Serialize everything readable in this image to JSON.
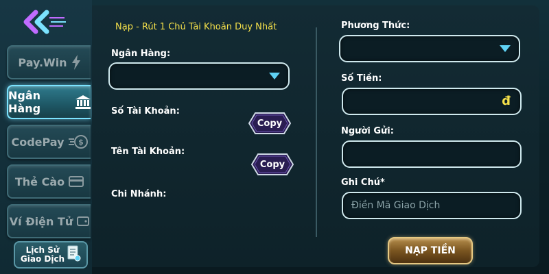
{
  "sidebar": {
    "back_icon": "double-chevron-left-icon",
    "tabs": [
      {
        "label": "Pay.Win",
        "icon": "lightning-icon",
        "active": false
      },
      {
        "label": "Ngân Hàng",
        "icon": "bank-icon",
        "active": true
      },
      {
        "label": "CodePay",
        "icon": "coin-icon",
        "active": false
      },
      {
        "label": "Thẻ Cào",
        "icon": "card-icon",
        "active": false
      },
      {
        "label": "Ví Điện Tử",
        "icon": "wallet-icon",
        "active": false
      }
    ],
    "history_line1": "Lịch Sử",
    "history_line2": "Giao Dịch",
    "help": "?"
  },
  "left": {
    "notice": "Nạp - Rút 1 Chủ Tài Khoản Duy Nhất",
    "bank_label": "Ngân Hàng:",
    "account_number_label": "Số Tài Khoản:",
    "account_name_label": "Tên Tài Khoản:",
    "branch_label": "Chi Nhánh:",
    "copy_label": "Copy"
  },
  "right": {
    "method_label": "Phương Thức:",
    "amount_label": "Số Tiền:",
    "currency_symbol": "đ",
    "sender_label": "Người Gửi:",
    "note_label": "Ghi Chú*",
    "note_placeholder": "Điền Mã Giao Dịch",
    "submit_label": "NẠP TIỀN"
  },
  "colors": {
    "accent_yellow": "#f5e04a",
    "active_tab_border": "#7be3ff",
    "caret": "#5fd2f5",
    "submit_gold": "#b58d4c"
  }
}
